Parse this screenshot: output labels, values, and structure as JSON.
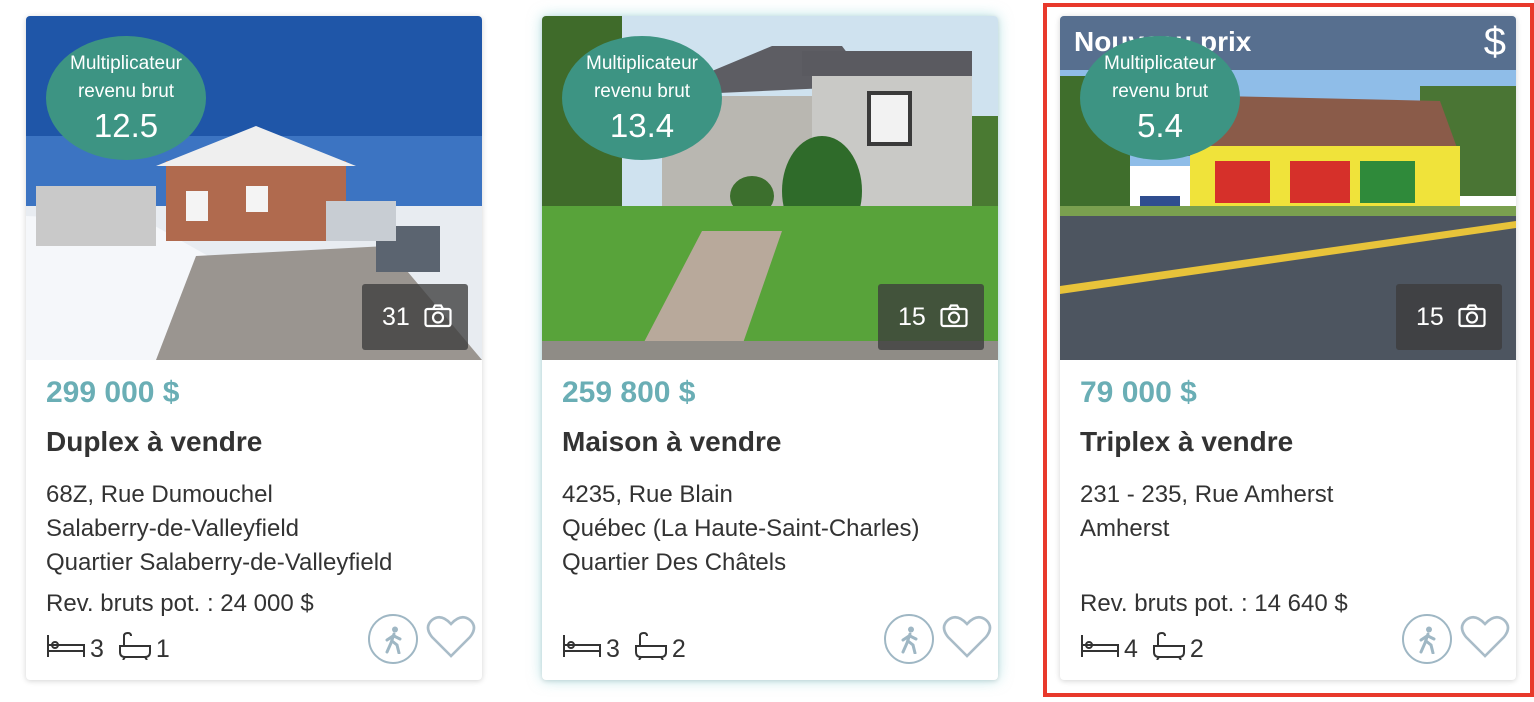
{
  "badge_label_line1": "Multiplicateur",
  "badge_label_line2": "revenu brut",
  "listings": [
    {
      "multiplier": "12.5",
      "photo_count": "31",
      "price": "299 000 $",
      "type": "Duplex à vendre",
      "address_line1": "68Z, Rue Dumouchel",
      "address_line2": "Salaberry-de-Valleyfield",
      "address_line3": "Quartier Salaberry-de-Valleyfield",
      "revenue": "Rev. bruts pot. : 24 000 $",
      "bedrooms": "3",
      "bathrooms": "1"
    },
    {
      "multiplier": "13.4",
      "photo_count": "15",
      "price": "259 800 $",
      "type": "Maison à vendre",
      "address_line1": "4235, Rue Blain",
      "address_line2": "Québec (La Haute-Saint-Charles)",
      "address_line3": "Quartier Des Châtels",
      "revenue": "",
      "bedrooms": "3",
      "bathrooms": "2"
    },
    {
      "banner": "Nouveau prix",
      "banner_icon": "$",
      "multiplier": "5.4",
      "photo_count": "15",
      "price": "79 000 $",
      "type": "Triplex à vendre",
      "address_line1": "231 - 235, Rue Amherst",
      "address_line2": "Amherst",
      "address_line3": "",
      "revenue": "Rev. bruts pot. : 14 640 $",
      "bedrooms": "4",
      "bathrooms": "2"
    }
  ],
  "colors": {
    "price": "#6aaeb5",
    "badge": "#3d9483",
    "selection_border": "#e8392b"
  },
  "icons": [
    "camera-icon",
    "bed-icon",
    "bathtub-icon",
    "pedestrian-icon",
    "heart-icon",
    "dollar-icon"
  ]
}
